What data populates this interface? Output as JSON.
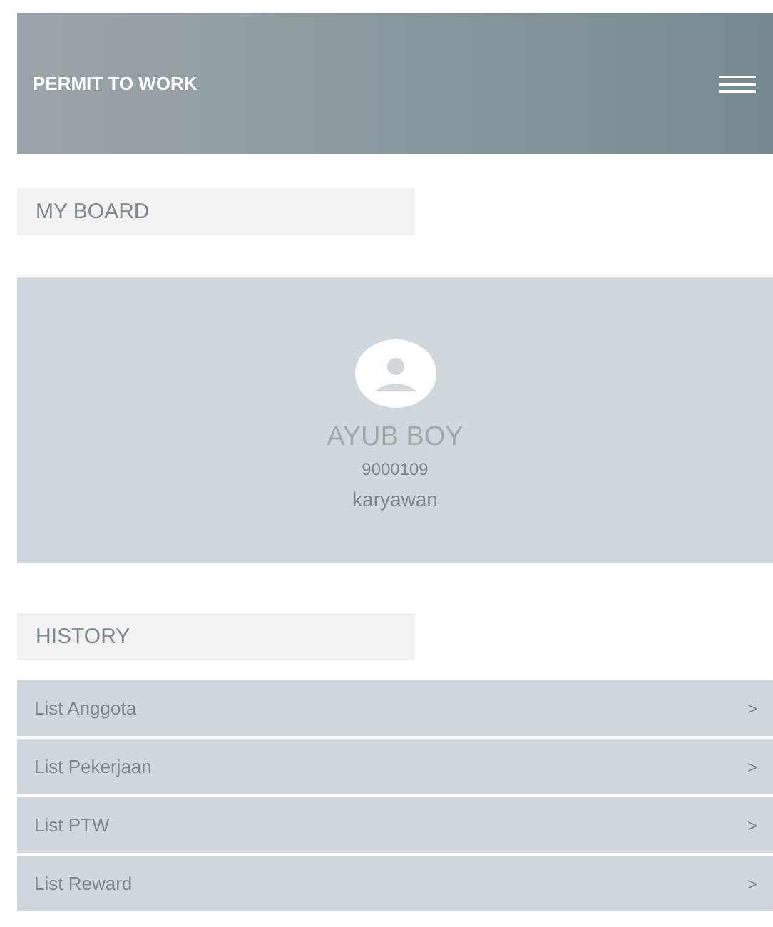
{
  "header": {
    "title": "PERMIT TO WORK"
  },
  "board": {
    "heading": "MY BOARD",
    "name": "AYUB BOY",
    "id_number": "9000109",
    "role": "karyawan"
  },
  "history": {
    "heading": "HISTORY",
    "items": [
      {
        "label": "List Anggota",
        "chevron": ">"
      },
      {
        "label": "List Pekerjaan",
        "chevron": ">"
      },
      {
        "label": "List PTW",
        "chevron": ">"
      },
      {
        "label": "List Reward",
        "chevron": ">"
      }
    ]
  }
}
